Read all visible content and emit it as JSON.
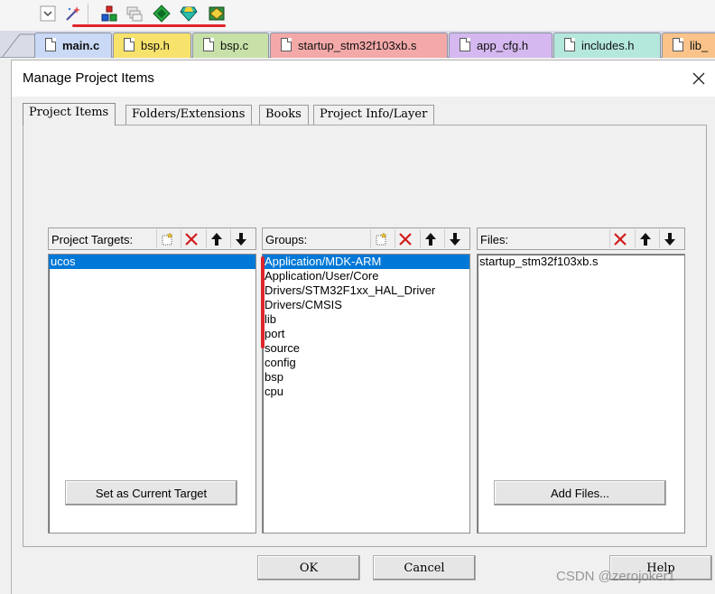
{
  "file_tabs": [
    {
      "label": "main.c",
      "color": "#c9d9f6",
      "active": true
    },
    {
      "label": "bsp.h",
      "color": "#f7e26b"
    },
    {
      "label": "bsp.c",
      "color": "#c8e1a8"
    },
    {
      "label": "startup_stm32f103xb.s",
      "color": "#f4a9a9"
    },
    {
      "label": "app_cfg.h",
      "color": "#d5b8ef"
    },
    {
      "label": "includes.h",
      "color": "#b5e8dc"
    },
    {
      "label": "lib_",
      "color": "#f9c38a"
    }
  ],
  "dialog": {
    "title": "Manage Project Items",
    "tabs": [
      "Project Items",
      "Folders/Extensions",
      "Books",
      "Project Info/Layer"
    ],
    "targets": {
      "label": "Project Targets:",
      "items": [
        {
          "text": "ucos",
          "selected": true
        }
      ]
    },
    "groups": {
      "label": "Groups:",
      "items": [
        {
          "text": "Application/MDK-ARM",
          "selected": true
        },
        {
          "text": "Application/User/Core"
        },
        {
          "text": "Drivers/STM32F1xx_HAL_Driver"
        },
        {
          "text": "Drivers/CMSIS"
        },
        {
          "text": "lib"
        },
        {
          "text": "port"
        },
        {
          "text": "source"
        },
        {
          "text": "config"
        },
        {
          "text": "bsp"
        },
        {
          "text": "cpu"
        }
      ]
    },
    "files": {
      "label": "Files:",
      "items": [
        {
          "text": "startup_stm32f103xb.s"
        }
      ]
    },
    "set_target_label": "Set as Current Target",
    "add_files_label": "Add Files...",
    "ok_label": "OK",
    "cancel_label": "Cancel",
    "help_label": "Help"
  },
  "watermark": "CSDN @zerojoker1",
  "colors": {
    "selection": "#0078d7",
    "annotation_red": "#e0242c",
    "delete_red": "#d11a1a"
  }
}
